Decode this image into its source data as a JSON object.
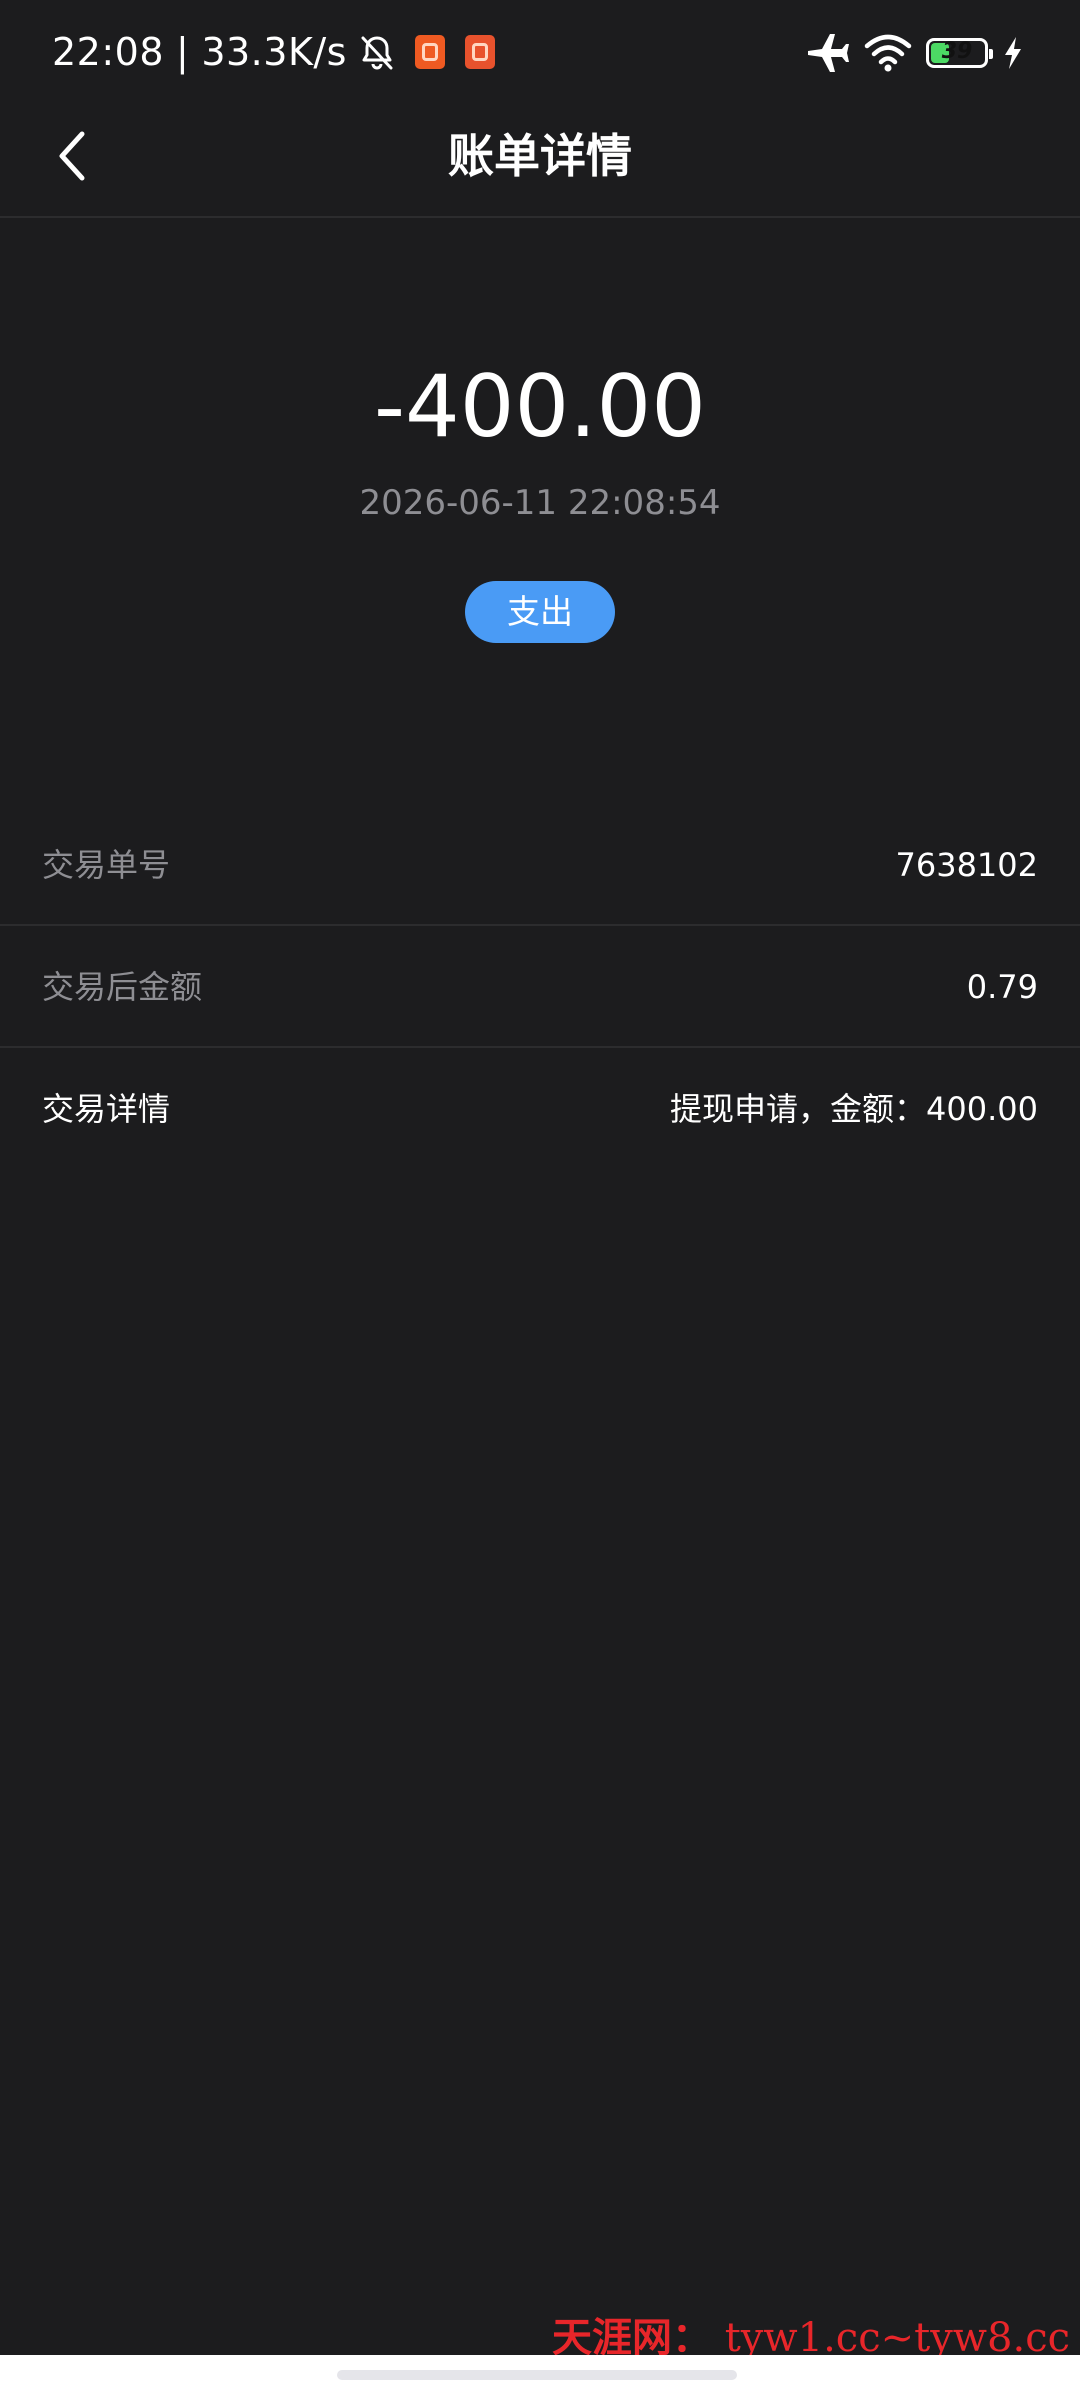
{
  "status_bar": {
    "time": "22:08",
    "separator": "|",
    "network_speed": "33.3K/s",
    "battery_level": "39",
    "battery_fraction": 0.39,
    "icons": [
      "bell-off-icon",
      "app-badge-icon",
      "app-badge-icon",
      "airplane-icon",
      "wifi-icon",
      "battery-icon",
      "charging-icon"
    ]
  },
  "nav": {
    "title": "账单详情",
    "back_icon": "chevron-left-icon"
  },
  "summary": {
    "amount": "-400.00",
    "timestamp": "2026-06-11 22:08:54",
    "type_label": "支出"
  },
  "details": [
    {
      "label": "交易单号",
      "value": "7638102"
    },
    {
      "label": "交易后金额",
      "value": "0.79"
    },
    {
      "label": "交易详情",
      "value": "提现申请，金额：400.00"
    }
  ],
  "watermark": {
    "name": "天涯网：",
    "urls": "tyw1.cc~tyw8.cc"
  },
  "colors": {
    "background": "#1c1c1e",
    "badge": "#4a9bf5",
    "muted_text": "#8e8e93",
    "divider": "#2c2c2e",
    "watermark": "#e8262a"
  }
}
